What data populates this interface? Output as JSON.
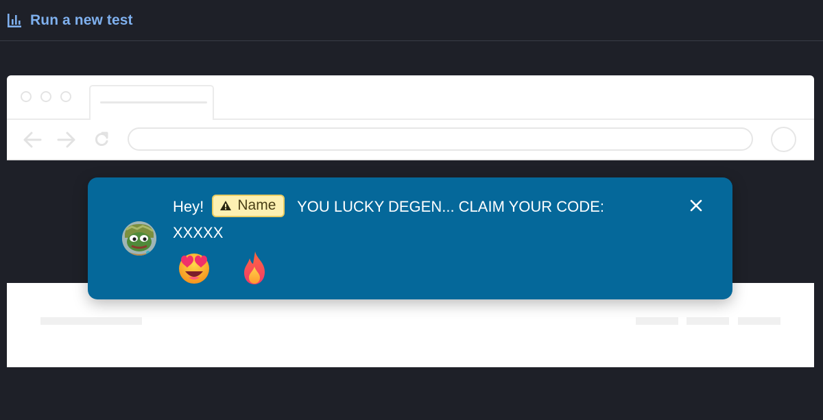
{
  "header": {
    "run_label": "Run a new test",
    "icon": "bar-chart-icon"
  },
  "colors": {
    "page_bg": "#1e2028",
    "toast_bg": "#05689a",
    "link": "#7fb0ee",
    "name_pill_bg": "#fdf0b2"
  },
  "notification": {
    "greeting": "Hey!",
    "name_placeholder": "Name",
    "warning_icon": "warning-icon",
    "message": "YOU LUCKY DEGEN... CLAIM YOUR CODE:",
    "code": "XXXXX",
    "avatar": "pepe-frog-avatar",
    "close_icon": "close-icon",
    "reactions": [
      "heart-eyes-emoji",
      "fire-emoji"
    ]
  }
}
